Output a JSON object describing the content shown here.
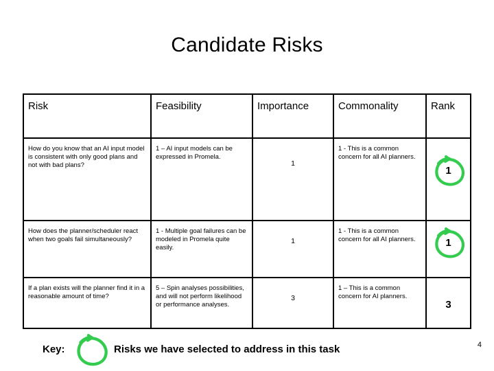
{
  "slide": {
    "title": "Candidate Risks",
    "page_number": "4"
  },
  "table": {
    "columns": [
      {
        "key": "risk",
        "label": "Risk"
      },
      {
        "key": "feasibility",
        "label": "Feasibility"
      },
      {
        "key": "importance",
        "label": "Importance"
      },
      {
        "key": "commonality",
        "label": "Commonality"
      },
      {
        "key": "rank",
        "label": "Rank"
      }
    ],
    "rows": [
      {
        "risk": "How do you know that an AI input model is consistent with only good plans and not with bad plans?",
        "feasibility": "1 – AI input models can be expressed in Promela.",
        "importance": "1",
        "commonality": "1 - This is a common concern for all AI planners.",
        "rank": "1",
        "rank_circled": true
      },
      {
        "risk": "How does the planner/scheduler react when two goals fail simultaneously?",
        "feasibility": "1 - Multiple goal failures can be modeled in Promela quite easily.",
        "importance": "1",
        "commonality": "1 - This is a common concern for all AI planners.",
        "rank": "1",
        "rank_circled": true
      },
      {
        "risk": "If a plan exists will the planner find it in a reasonable amount of time?",
        "feasibility": "5 – Spin analyses possibilities, and will not perform likelihood or performance analyses.",
        "importance": "3",
        "commonality": "1 – This is a common concern for AI planners.",
        "rank": "3",
        "rank_circled": false
      }
    ]
  },
  "key": {
    "label": "Key:",
    "description": "Risks we have selected to address in this task",
    "marker_icon": "green-lasso-circle-icon"
  },
  "colors": {
    "annotation_green": "#33cc4e",
    "table_border": "#000000",
    "text": "#000000",
    "background": "#ffffff"
  }
}
